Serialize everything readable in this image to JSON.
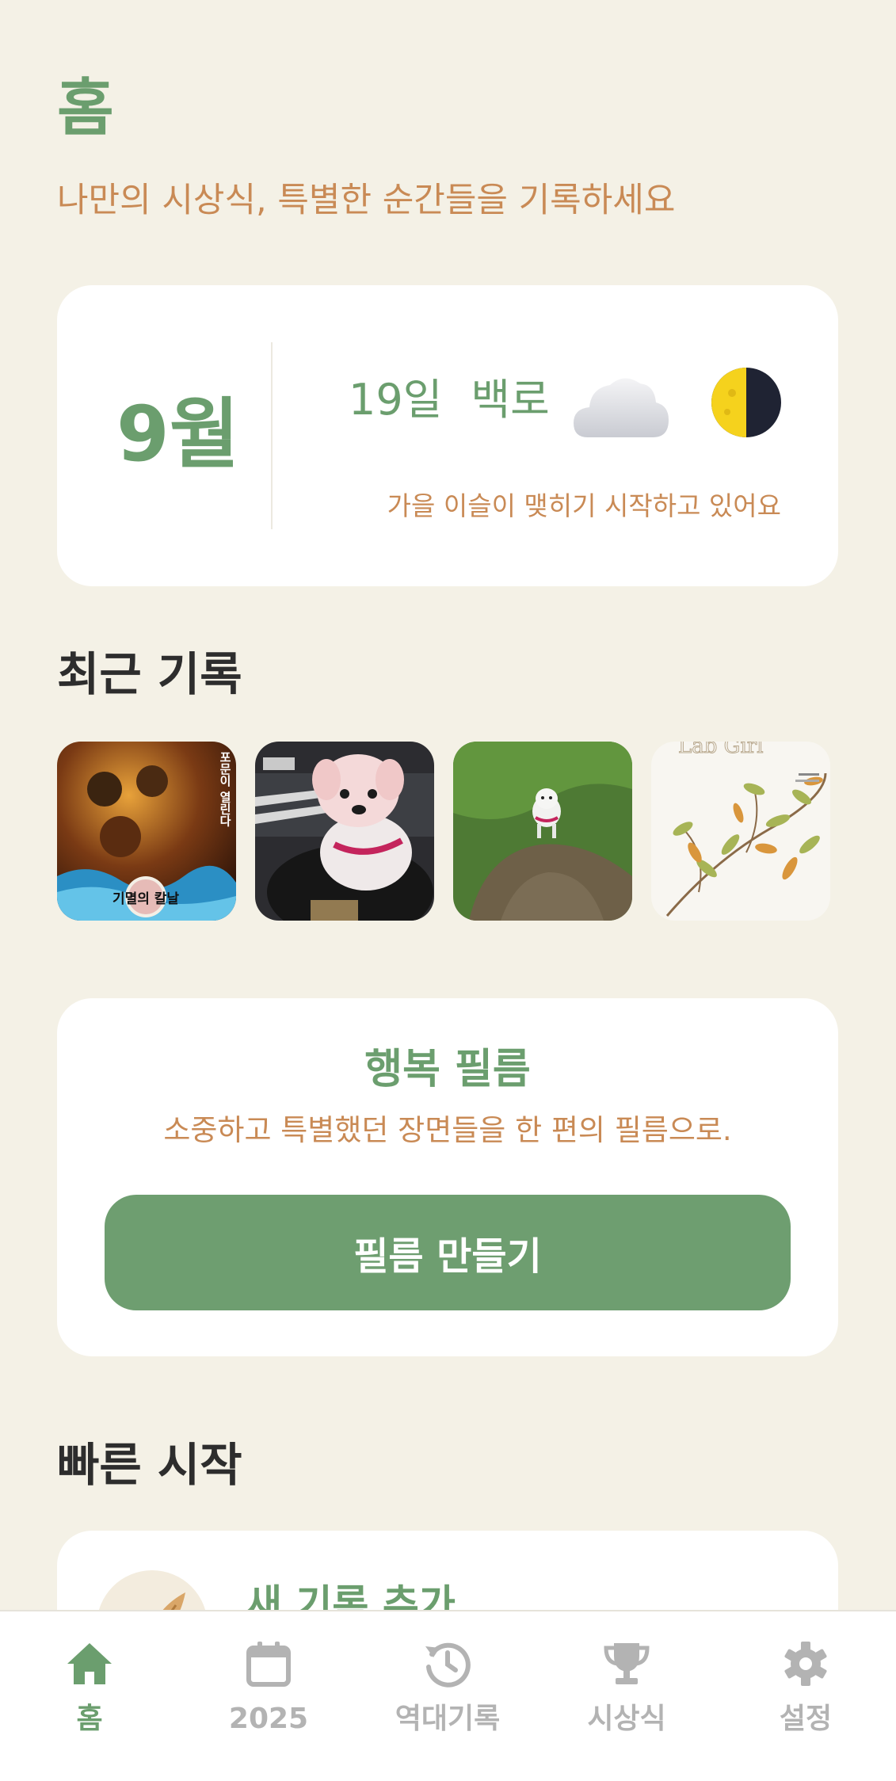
{
  "header": {
    "title": "홈",
    "subtitle": "나만의 시상식, 특별한 순간들을 기록하세요"
  },
  "season": {
    "month": "9월",
    "day": "19일",
    "term": "백로",
    "weather_icon": "cloud-icon",
    "moon_icon": "first-quarter-moon-icon",
    "description": "가을 이슬이 맺히기 시작하고 있어요"
  },
  "recent": {
    "title": "최근 기록",
    "items": [
      {
        "icon": "movie-poster-thumbnail",
        "poster_text": "기멸의 칼날",
        "side_text": "포문이 열린다"
      },
      {
        "icon": "dog-photo-thumbnail"
      },
      {
        "icon": "dog-on-grass-thumbnail"
      },
      {
        "icon": "book-cover-thumbnail",
        "cover_text": "Lab Girl"
      }
    ]
  },
  "film": {
    "title": "행복 필름",
    "description": "소중하고 특별했던 장면들을 한 편의 필름으로.",
    "button_label": "필름 만들기"
  },
  "quick_start": {
    "title": "빠른 시작",
    "items": [
      {
        "label": "새 기록 추가",
        "icon": "feather-icon"
      }
    ]
  },
  "tabbar": {
    "tabs": [
      {
        "label": "홈",
        "icon": "home-icon",
        "active": true
      },
      {
        "label": "2025",
        "icon": "calendar-icon",
        "active": false
      },
      {
        "label": "역대기록",
        "icon": "history-icon",
        "active": false
      },
      {
        "label": "시상식",
        "icon": "trophy-icon",
        "active": false
      },
      {
        "label": "설정",
        "icon": "gear-icon",
        "active": false
      }
    ]
  },
  "colors": {
    "background": "#f4f1e6",
    "primary_green": "#6b9e6e",
    "accent_orange": "#c98a55",
    "inactive_gray": "#b3b3b3"
  }
}
